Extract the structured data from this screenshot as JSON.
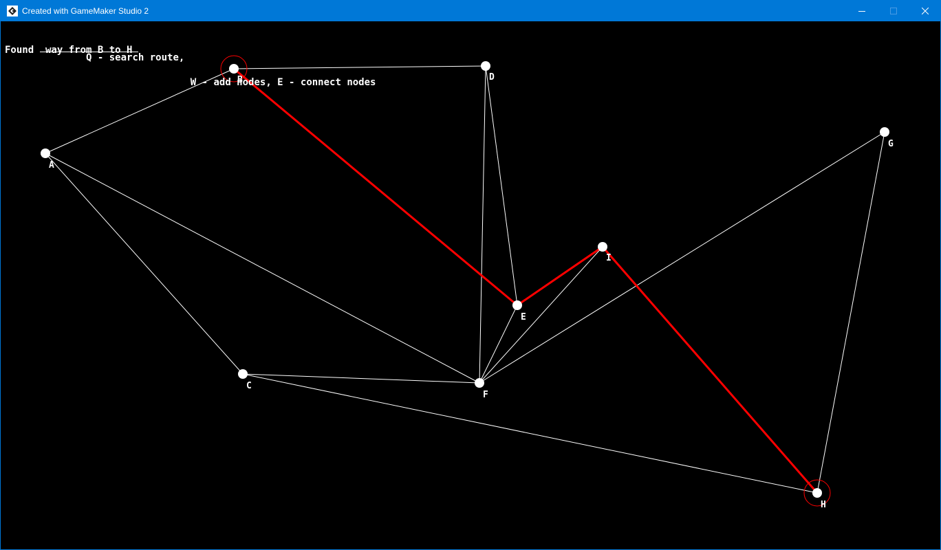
{
  "window": {
    "title": "Created with GameMaker Studio 2",
    "icon": "gamemaker-icon",
    "controls": [
      "minimize-icon",
      "maximize-icon",
      "close-icon"
    ]
  },
  "hud": {
    "search_hint": "Q - search route,",
    "other_hints": " W - add nodes, E - connect nodes",
    "status": "Found  way from B to H"
  },
  "colors": {
    "titlebar": "#0078d7",
    "background": "#000000",
    "edge": "#ffffff",
    "route": "#ff0000",
    "node": "#ffffff"
  },
  "graph": {
    "nodes": [
      "A",
      "B",
      "C",
      "D",
      "E",
      "F",
      "G",
      "H",
      "I"
    ],
    "edges": [
      [
        "A",
        "B"
      ],
      [
        "A",
        "C"
      ],
      [
        "A",
        "F"
      ],
      [
        "B",
        "D"
      ],
      [
        "B",
        "E"
      ],
      [
        "C",
        "F"
      ],
      [
        "C",
        "H"
      ],
      [
        "D",
        "E"
      ],
      [
        "D",
        "F"
      ],
      [
        "E",
        "F"
      ],
      [
        "E",
        "I"
      ],
      [
        "F",
        "I"
      ],
      [
        "F",
        "G"
      ],
      [
        "G",
        "H"
      ],
      [
        "I",
        "H"
      ]
    ],
    "route": [
      "B",
      "E",
      "I",
      "H"
    ],
    "start": "B",
    "end": "H"
  }
}
